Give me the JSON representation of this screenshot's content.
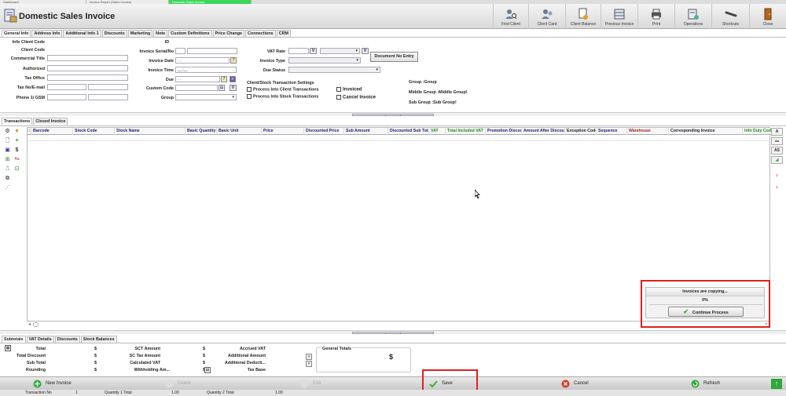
{
  "window_tabs": [
    "Dashboard",
    "Invoice Report (Sales Invoice)",
    "Domestic Sales Invoice"
  ],
  "app": {
    "title": "Domestic Sales Invoice"
  },
  "toolbar": [
    {
      "label": "Find Client",
      "icon": "find-client-icon"
    },
    {
      "label": "Client Card",
      "icon": "client-card-icon"
    },
    {
      "label": "Client Balance",
      "icon": "client-balance-icon"
    },
    {
      "label": "Previous Invoice",
      "icon": "previous-invoice-icon"
    },
    {
      "label": "Print",
      "icon": "printer-icon"
    },
    {
      "label": "Operations",
      "icon": "operations-icon"
    },
    {
      "label": "Shortcuts",
      "icon": "shortcuts-icon"
    },
    {
      "label": "Close",
      "icon": "close-door-icon"
    }
  ],
  "form_tabs": [
    "General Info",
    "Address Info",
    "Additional Info 1",
    "Discounts",
    "Marketing",
    "Note",
    "Custom Definitions",
    "Price Change",
    "Connections",
    "CRM"
  ],
  "form": {
    "info_client_code": "Info Client Code",
    "client_code": "Client Code",
    "commercial_title": "Commercial Title",
    "authorized": "Authorized",
    "tax_office": "Tax Office",
    "tax_no_email": "Tax No/E-mail",
    "phone_gsm": "Phone 1/ GSM",
    "id": "ID",
    "invoice_serial_no": "Invoice Serial/No",
    "invoice_date": "Invoice Date",
    "invoice_date_value": ". .",
    "invoice_time": "Invoice Time",
    "invoice_time_value": "__:__",
    "due": "Due",
    "due_value": ". .",
    "custom_code": "Custom Code",
    "group": "Group",
    "vat_rate": "VAT Rate",
    "invoice_type": "Invoice Type",
    "due_status": "Due Status",
    "document_no_entry": "Document No Entry",
    "settings_title": "Client/Stock Transaction Settings",
    "process_client": "Process Into Client Transactions",
    "process_stock": "Process Into Stock Transactions",
    "invoiced": "Invoiced",
    "cancel_invoice": "Cancel Invoice",
    "group_info": "Group :Group",
    "middle_group_info": "Middle Group :Middle Group!",
    "sub_group_info": "Sub Group :Sub Group!",
    "v_label": "V"
  },
  "transaction_tabs": [
    "Transactions",
    "Closed Invoice"
  ],
  "grid": {
    "columns": [
      {
        "label": "Barcode",
        "color": "#1a1a7a"
      },
      {
        "label": "Stock Code",
        "color": "#1a1a7a"
      },
      {
        "label": "Stock Name",
        "color": "#1a1a7a"
      },
      {
        "label": "Basic Quantity",
        "color": "#1a1a7a"
      },
      {
        "label": "Basic Unit",
        "color": "#1a1a7a"
      },
      {
        "label": "Price",
        "color": "#1a1a7a"
      },
      {
        "label": "Discounted Price",
        "color": "#1a1a7a"
      },
      {
        "label": "Sub Amount",
        "color": "#1a1a7a"
      },
      {
        "label": "Discounted Sub Total",
        "color": "#1a1a7a"
      },
      {
        "label": "VAT",
        "color": "#1a8a1a"
      },
      {
        "label": "Total Included VAT",
        "color": "#1a8a1a"
      },
      {
        "label": "Promotion Discount",
        "color": "#1a1a7a"
      },
      {
        "label": "Amount After Discount",
        "color": "#1a1a7a"
      },
      {
        "label": "Exception Code",
        "color": "#1a1a1a"
      },
      {
        "label": "Sequence",
        "color": "#1a1a7a"
      },
      {
        "label": "Warehouse",
        "color": "#9a1a1a"
      },
      {
        "label": "Corresponding Invoice",
        "color": "#1a1a1a"
      },
      {
        "label": "Info Duty Code",
        "color": "#1a8a1a"
      }
    ]
  },
  "dialog": {
    "title": "Invoices are copying...",
    "percent_text": "0%",
    "progress": 0,
    "button": "Continue Process"
  },
  "subtotal_tabs": [
    "Subtotals",
    "VAT Details",
    "Discounts",
    "Stock Balances"
  ],
  "subtotals": {
    "col1": [
      "Total",
      "Total Discount",
      "Sub Total",
      "Rounding"
    ],
    "col2": [
      "SCT Amount",
      "SC Tax Amount",
      "Calculated VAT",
      "Withholding Am..."
    ],
    "col3": [
      "Accrued VAT",
      "Additional Amount",
      "Additional Deducti...",
      "Tax Base"
    ],
    "currency": "$",
    "general_totals": "General Totals",
    "arrow": ">"
  },
  "bottom_buttons": {
    "new_invoice": "New Invoice",
    "delete": "Delete",
    "edit": "Edit",
    "save": "Save",
    "cancel": "Cancel",
    "refresh": "Refresh"
  },
  "status": {
    "transaction_no_label": "Transaction No",
    "transaction_no_value": "1",
    "quantity1_label": "Quantity 1 Total",
    "quantity1_value": "1.00",
    "quantity2_label": "Quantity 2 Total",
    "quantity2_value": "1.00"
  },
  "colors": {
    "accent": "#3cd65a",
    "highlight": "#e02020"
  }
}
